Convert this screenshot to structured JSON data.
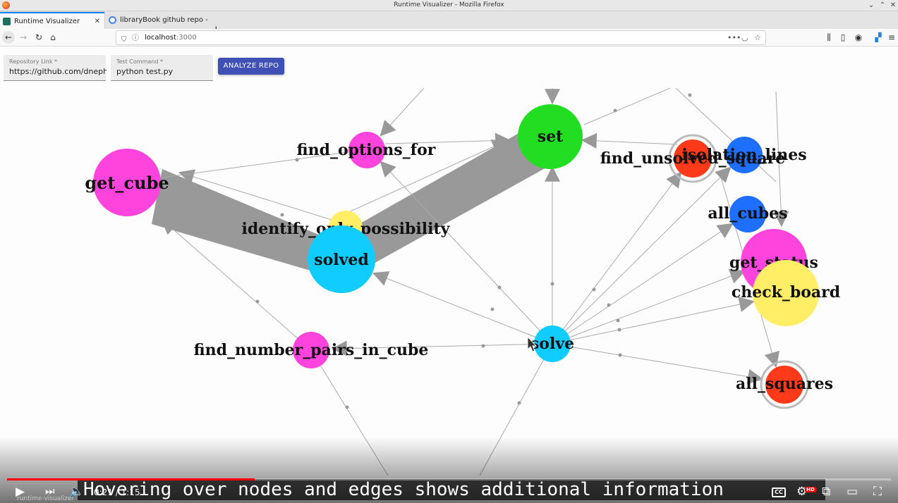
{
  "window": {
    "title": "Runtime Visualizer - Mozilla Firefox"
  },
  "tabs": [
    {
      "label": "Runtime Visualizer",
      "favicon_color": "#1f6f5f"
    },
    {
      "label": "libraryBook github repo - G",
      "favicon_color": "#4285f4"
    }
  ],
  "url": {
    "host": "localhost",
    "port": ":3000"
  },
  "form": {
    "repo_label": "Repository Link *",
    "repo_value": "https://github.com/dnephin/S",
    "cmd_label": "Test Command *",
    "cmd_value": "python test.py",
    "analyze_label": "ANALYZE REPO"
  },
  "graph": {
    "nodes": [
      {
        "id": "get_cube",
        "color": "#ff44dd"
      },
      {
        "id": "find_options_for",
        "color": "#ff44dd"
      },
      {
        "id": "set",
        "color": "#22dd22"
      },
      {
        "id": "find_unsolved_square",
        "color": "#ff3a1a"
      },
      {
        "id": "isolation_lines",
        "color": "#1e6fff"
      },
      {
        "id": "all_cubes",
        "color": "#1e6fff"
      },
      {
        "id": "identify_only_possibility",
        "color": "#ffee66"
      },
      {
        "id": "solved",
        "color": "#11ccff"
      },
      {
        "id": "get_status",
        "color": "#ff44dd"
      },
      {
        "id": "check_board",
        "color": "#ffee66"
      },
      {
        "id": "solve",
        "color": "#11ccff"
      },
      {
        "id": "find_number_pairs_in_cube",
        "color": "#ff44dd"
      },
      {
        "id": "all_squares",
        "color": "#ff3a1a"
      }
    ]
  },
  "video": {
    "subtitle": "Hovering over nodes and edges shows additional information",
    "elapsed": "0:21",
    "duration": "1:15",
    "time_separator": " / ",
    "progress_fraction": 0.28,
    "cc_label": "CC",
    "hd_label": "HD",
    "taskbar_label": "runtime-visualizer"
  }
}
